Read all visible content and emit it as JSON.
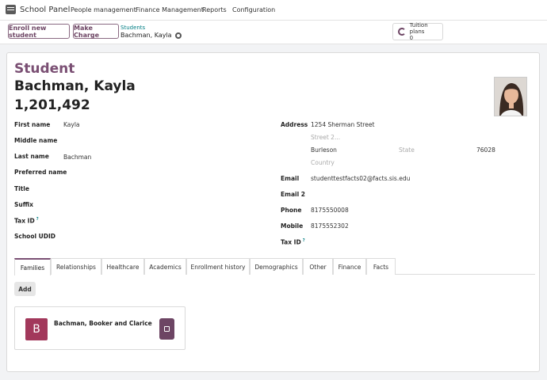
{
  "nav": {
    "brand": "School Panel",
    "items": [
      "People management",
      "Finance Management",
      "Reports",
      "Configuration"
    ]
  },
  "control": {
    "enroll_label": "Enroll new student",
    "charge_label": "Make Charge",
    "breadcrumb_parent": "Students",
    "breadcrumb_current": "Bachman, Kayla",
    "tuition_label": "Tuition plans",
    "tuition_count": "0"
  },
  "header": {
    "title": "Student",
    "name": "Bachman, Kayla",
    "id": "1,201,492"
  },
  "left_fields": {
    "first_name_label": "First name",
    "first_name": "Kayla",
    "middle_name_label": "Middle name",
    "last_name_label": "Last name",
    "last_name": "Bachman",
    "preferred_label": "Preferred name",
    "title_label": "Title",
    "suffix_label": "Suffix",
    "taxid_label": "Tax ID",
    "udid_label": "School UDID",
    "help_mark": "?"
  },
  "right_fields": {
    "address_label": "Address",
    "street": "1254 Sherman Street",
    "street2_placeholder": "Street 2...",
    "city": "Burleson",
    "state_placeholder": "State",
    "zip": "76028",
    "country_placeholder": "Country",
    "email_label": "Email",
    "email": "studenttestfacts02@facts.sis.edu",
    "email2_label": "Email 2",
    "phone_label": "Phone",
    "phone": "8175550008",
    "mobile_label": "Mobile",
    "mobile": "8175552302",
    "taxid_label": "Tax ID",
    "help_mark": "?"
  },
  "tabs": [
    "Families",
    "Relationships",
    "Healthcare",
    "Academics",
    "Enrollment history",
    "Demographics",
    "Other",
    "Finance",
    "Facts"
  ],
  "families": {
    "add_label": "Add",
    "card_initial": "B",
    "card_name": "Bachman, Booker and Clarice"
  },
  "colors": {
    "accent": "#7a4f73",
    "link": "#017e84",
    "avatar": "#a2385b",
    "button": "#6d4564"
  }
}
